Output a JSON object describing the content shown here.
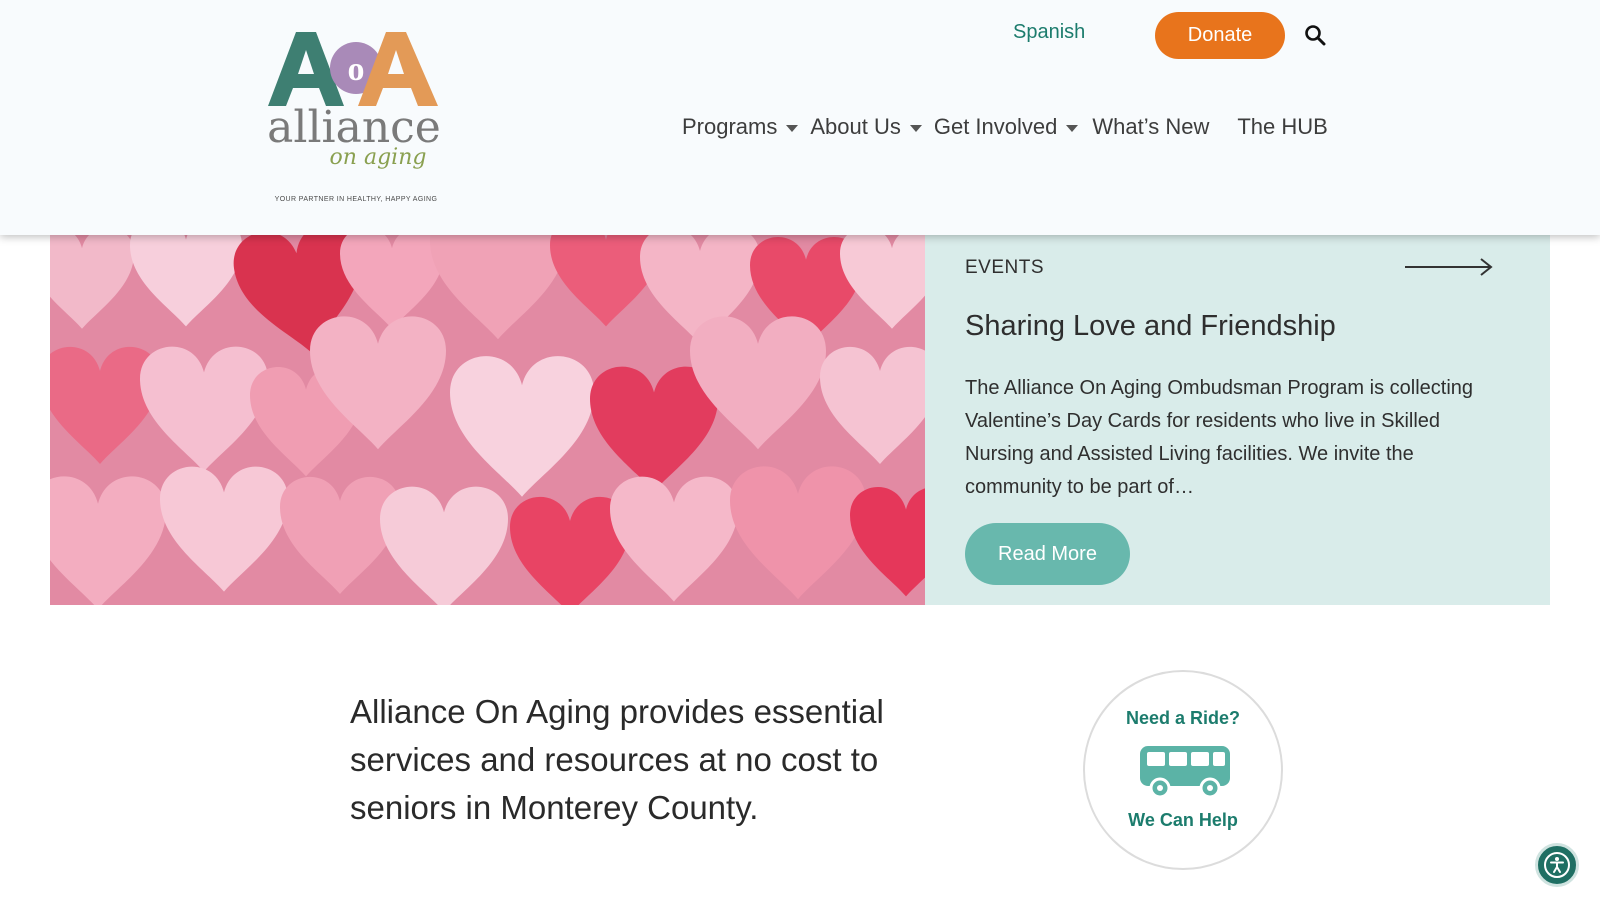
{
  "header": {
    "logo": {
      "letters": "AoA",
      "word": "alliance",
      "script": "on aging",
      "tagline": "YOUR PARTNER IN HEALTHY, HAPPY AGING"
    },
    "spanish_label": "Spanish",
    "donate_label": "Donate",
    "search_icon": "search-icon",
    "nav": {
      "programs": "Programs",
      "about": "About Us",
      "get_involved": "Get Involved",
      "whats_new": "What’s New",
      "hub": "The HUB"
    }
  },
  "feature": {
    "category": "EVENTS",
    "title": "Sharing Love and Friendship",
    "body": "The Alliance On Aging Ombudsman Program is collecting Valentine’s Day Cards for residents who live in Skilled Nursing and Assisted Living facilities. We invite the community to be part of…",
    "read_more_label": "Read More",
    "image_icon": "hearts-image"
  },
  "mission": {
    "text": "Alliance On Aging provides essential services and resources at no cost to seniors in Monterey County."
  },
  "ride_badge": {
    "top": "Need a Ride?",
    "bottom": "We Can Help",
    "icon": "bus-icon"
  },
  "accessibility_icon": "accessibility-icon",
  "colors": {
    "teal": "#1c7c6d",
    "donate_orange": "#e8741c",
    "panel_bg": "#d9ecea",
    "read_more_bg": "#68b8ad"
  }
}
